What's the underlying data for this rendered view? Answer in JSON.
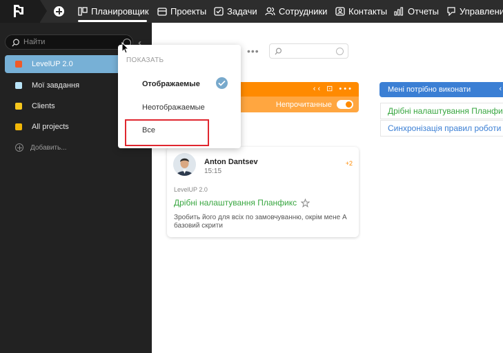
{
  "topnav": {
    "items": [
      {
        "label": "Планировщик",
        "icon": "planner-icon",
        "active": true
      },
      {
        "label": "Проекты",
        "icon": "projects-icon"
      },
      {
        "label": "Задачи",
        "icon": "tasks-icon"
      },
      {
        "label": "Сотрудники",
        "icon": "employees-icon"
      },
      {
        "label": "Контакты",
        "icon": "contacts-icon"
      },
      {
        "label": "Отчеты",
        "icon": "reports-icon"
      },
      {
        "label": "Управлени",
        "icon": "management-icon"
      }
    ]
  },
  "sidebar": {
    "search_placeholder": "Найти",
    "projects": [
      {
        "label": "LevelUP 2.0",
        "color": "#f05a28",
        "active": true
      },
      {
        "label": "Мої завдання",
        "color": "#b9e4f7"
      },
      {
        "label": "Clients",
        "color": "#f7c71d"
      },
      {
        "label": "All projects",
        "color": "#f2b707"
      }
    ],
    "add_label": "Добавить..."
  },
  "dropdown": {
    "heading": "ПОКАЗАТЬ",
    "options": [
      {
        "label": "Отображаемые",
        "selected": true
      },
      {
        "label": "Неотображаемые",
        "selected": false
      },
      {
        "label": "Все",
        "selected": false
      }
    ]
  },
  "columns": {
    "orange": {
      "header_color": "#ff8a00",
      "filter_label": "Непрочитанные",
      "filter_on": true
    },
    "blue": {
      "title": "Мені потрібно виконати",
      "header_color": "#3b7fd4",
      "items": [
        {
          "label": "Дрібні налаштування Планфи",
          "color": "#38a640"
        },
        {
          "label": "Синхронізація правил роботи",
          "color": "#3b7fd4"
        }
      ]
    }
  },
  "card": {
    "author": "Anton Dantsev",
    "time": "15:15",
    "badge": "+2",
    "project": "LevelUP 2.0",
    "title": "Дрібні налаштування Планфикс",
    "description": "Зробить його для всіх по замовчуванню, окрім мене А базовий скрити"
  }
}
